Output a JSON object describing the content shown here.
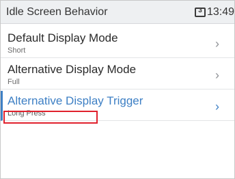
{
  "header": {
    "title": "Idle Screen Behavior",
    "badge": "3",
    "time": "13:49"
  },
  "menu": {
    "items": [
      {
        "label": "Default Display Mode",
        "value": "Short",
        "chevron": "›"
      },
      {
        "label": "Alternative Display Mode",
        "value": "Full",
        "chevron": "›"
      },
      {
        "label": "Alternative Display Trigger",
        "value": "Long Press",
        "chevron": "›"
      }
    ],
    "selected_index": 2
  },
  "colors": {
    "accent": "#3d7fc4",
    "header_bg": "#eef0f2",
    "highlight": "#e0202c"
  },
  "icons": {
    "badge": "message-count-icon",
    "chevron": "chevron-right-icon"
  }
}
